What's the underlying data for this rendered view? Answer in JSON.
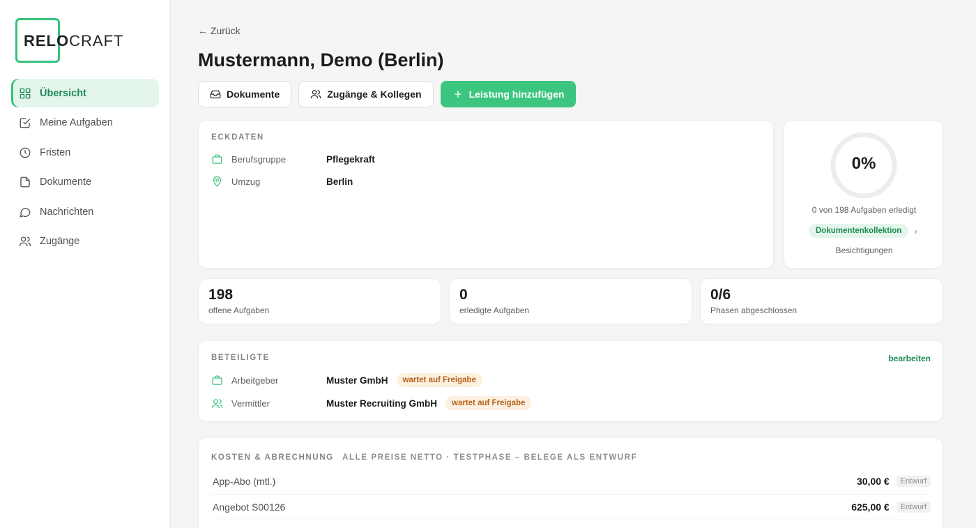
{
  "brand": {
    "logo_bold": "RELO",
    "logo_light": "CRAFT"
  },
  "sidebar": {
    "items": [
      {
        "label": "Übersicht",
        "icon": "grid-icon",
        "active": true
      },
      {
        "label": "Meine Aufgaben",
        "icon": "checkbox-icon"
      },
      {
        "label": "Fristen",
        "icon": "clock-icon"
      },
      {
        "label": "Dokumente",
        "icon": "file-icon"
      },
      {
        "label": "Nachrichten",
        "icon": "chat-icon"
      },
      {
        "label": "Zugänge",
        "icon": "users-icon"
      }
    ]
  },
  "header": {
    "back_label": "← Zurück",
    "title": "Mustermann, Demo (Berlin)"
  },
  "actions": {
    "documents": "Dokumente",
    "access": "Zugänge & Kollegen",
    "add_service": "Leistung hinzufügen"
  },
  "eckdaten": {
    "label": "ECKDATEN",
    "rows": [
      {
        "key": "Berufsgruppe",
        "value": "Pflegekraft",
        "icon": "briefcase-icon"
      },
      {
        "key": "Umzug",
        "value": "Berlin",
        "icon": "location-pin-icon"
      }
    ]
  },
  "progress": {
    "percent_label": "0%",
    "percent": 0,
    "summary": "0 von 198 Aufgaben erledigt",
    "phase": "Dokumentenkollektion",
    "next_phase": "Besichtigungen"
  },
  "stats": [
    {
      "value": "198",
      "label": "offene Aufgaben"
    },
    {
      "value": "0",
      "label": "erledigte Aufgaben"
    },
    {
      "value": "0/6",
      "label": "Phasen abgeschlossen"
    }
  ],
  "beteiligte": {
    "label": "BETEILIGTE",
    "edit_label": "bearbeiten",
    "rows": [
      {
        "key": "Arbeitgeber",
        "value": "Muster GmbH",
        "status": "wartet auf Freigabe",
        "icon": "briefcase-icon"
      },
      {
        "key": "Vermittler",
        "value": "Muster Recruiting GmbH",
        "status": "wartet auf Freigabe",
        "icon": "users-icon"
      }
    ]
  },
  "kosten": {
    "label": "KOSTEN & ABRECHNUNG",
    "sub_label": "ALLE PREISE NETTO · TESTPHASE – BELEGE ALS ENTWURF",
    "rows": [
      {
        "name": "App-Abo (mtl.)",
        "amount": "30,00 €",
        "status": "Entwurf"
      },
      {
        "name": "Angebot S00126",
        "amount": "625,00 €",
        "status": "Entwurf"
      }
    ]
  },
  "colors": {
    "accent": "#3cc57f",
    "accent_dark": "#1f8a55",
    "warning_bg": "#fdf0e1",
    "warning_text": "#b4621a"
  }
}
